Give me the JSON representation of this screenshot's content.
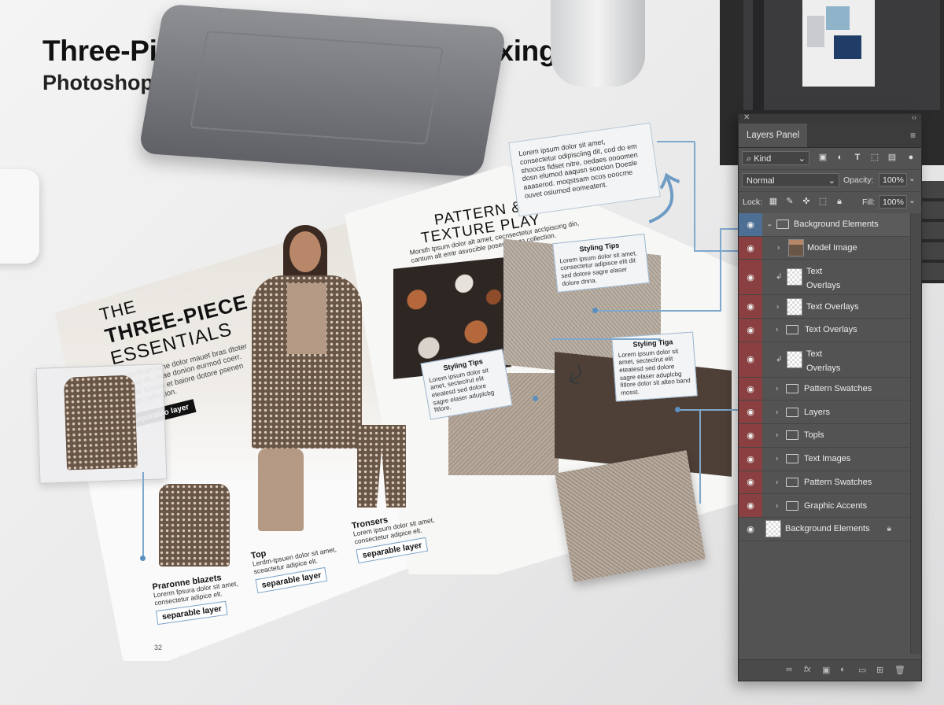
{
  "header": {
    "title": "Three-Piece Fashion & Pattern Mixing",
    "subtitle": "Photoshop Separable Layers"
  },
  "magazine": {
    "left_page": {
      "headline_line1": "THE",
      "headline_line2": "THREE-PIECE",
      "headline_line3": "ESSENTIALS",
      "blurb": "Chstenfium ixme dolor mauet bras dtoter pivatng dit, ceae donion eurmod coerr. Urgoat fabore et baiore dotore psenen oungn collection.",
      "chip_label": "separablo layer",
      "page_number": "32"
    },
    "products": [
      {
        "name": "Praronne blazets",
        "copy": "Lorerm fpsura dolor sit amet, consectetur adipice elt.",
        "tag": "separable layer"
      },
      {
        "name": "Top",
        "copy": "Lerdm-tpsuen dolor sit amet, sceactetur adipice elt.",
        "tag": "separable layer"
      },
      {
        "name": "Tronsers",
        "copy": "Lorem ipsum dolor sit amet, consectetur adipice elt.",
        "tag": "separable layer"
      }
    ],
    "right_page": {
      "title_line1": "PATTERN &",
      "title_line2": "TEXTURE PLAY",
      "subtitle": "Morsth tpsum dolor alt amet, cecnsectetur acclpiscing din, cantum alt emtr asvocible poses maxta collection.",
      "callouts": [
        {
          "title": "Styling Tips",
          "text": "Lorem ipsum dolor sit amet, consectetur adipisce elit dit sed dotore sagre elaser dolore dnna."
        },
        {
          "title": "Styling Tips",
          "text": "Lorem ipsum dolor sit amet, secteclrut elit eteatesd sed dolore sagre elaser aduplcbg fitlore."
        },
        {
          "title": "Styling Tiga",
          "text": "Lorem ipsum dolor sit amet, secteclrut elit eteatesd sed dolore sagre elaser aduplcbg fitlore dolor sit alteo band mosst."
        }
      ],
      "note": "Lorem ipsum dolor sit amet, consectetur odipisciing dit, cod do em shoocts fidset nitre, oedaes oooomen dosn elumod aaqusn soocion Doesle aaaserod. moqstsam ocos ooocme ouvet osiumod eomeatent."
    }
  },
  "layers_panel": {
    "tab_label": "Layers Panel",
    "filter_kind": "Kind",
    "blend_mode": "Normal",
    "opacity_label": "Opacity:",
    "opacity_value": "100%",
    "lock_label": "Lock:",
    "fill_label": "Fill:",
    "fill_value": "100%",
    "layers": [
      {
        "name": "Background Elements",
        "type": "group-open",
        "eye_color": "#4d6f93"
      },
      {
        "name": "Model Image",
        "type": "image",
        "eye_color": "#8a4040"
      },
      {
        "name": "Text",
        "name2": "Overlays",
        "type": "text-tall",
        "eye_color": "#8a4040"
      },
      {
        "name": "Text Overlays",
        "type": "image-sub",
        "eye_color": "#8a4040"
      },
      {
        "name": "Text Overlays",
        "type": "group",
        "eye_color": "#8a4040"
      },
      {
        "name": "Text",
        "name2": "Overlays",
        "type": "text-tall",
        "eye_color": "#8a4040"
      },
      {
        "name": "Pattern Swatches",
        "type": "group",
        "eye_color": "#8a4040"
      },
      {
        "name": "Layers",
        "type": "group",
        "eye_color": "#8a4040"
      },
      {
        "name": "Topls",
        "type": "group",
        "eye_color": "#8a4040"
      },
      {
        "name": "Text Images",
        "type": "group",
        "eye_color": "#8a4040"
      },
      {
        "name": "Pattern Swatches",
        "type": "group",
        "eye_color": "#8a4040"
      },
      {
        "name": "Graphic Accents",
        "type": "group",
        "eye_color": "#8a4040"
      },
      {
        "name": "Background Elements",
        "type": "locked",
        "eye_color": "#535353"
      }
    ]
  },
  "colors": {
    "accent_blue": "#7ea8cc",
    "layer_red": "#8a4040",
    "layer_blue": "#4d6f93",
    "panel_bg": "#535353"
  }
}
